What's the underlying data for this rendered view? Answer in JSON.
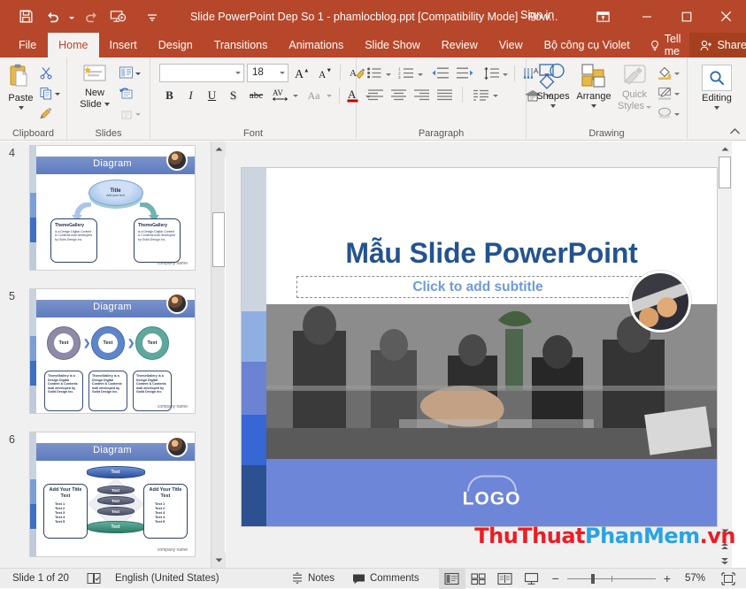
{
  "titlebar": {
    "title": "Slide PowerPoint Dep So 1 - phamlocblog.ppt [Compatibility Mode]  -  Pow...",
    "signin": "Sign in",
    "qat": [
      {
        "name": "save-icon",
        "label": "Save"
      },
      {
        "name": "undo-icon",
        "label": "Undo"
      },
      {
        "name": "redo-icon",
        "label": "Redo"
      },
      {
        "name": "start-presentation-icon",
        "label": "Start From Beginning"
      },
      {
        "name": "customize-qat-icon",
        "label": "Customize Quick Access Toolbar"
      }
    ],
    "ribbon_display_label": "Ribbon Display Options",
    "minimize_label": "Minimize",
    "maximize_label": "Restore Down",
    "close_label": "Close"
  },
  "tabs": [
    {
      "label": "File",
      "active": false
    },
    {
      "label": "Home",
      "active": true
    },
    {
      "label": "Insert",
      "active": false
    },
    {
      "label": "Design",
      "active": false
    },
    {
      "label": "Transitions",
      "active": false
    },
    {
      "label": "Animations",
      "active": false
    },
    {
      "label": "Slide Show",
      "active": false
    },
    {
      "label": "Review",
      "active": false
    },
    {
      "label": "View",
      "active": false
    },
    {
      "label": "Bộ công cụ Violet",
      "active": false
    }
  ],
  "tellme": "Tell me",
  "share": "Share",
  "ribbon": {
    "clipboard": {
      "label": "Clipboard",
      "paste": "Paste",
      "cut_label": "Cut",
      "copy_label": "Copy",
      "format_painter_label": "Format Painter"
    },
    "slides": {
      "label": "Slides",
      "new_slide_line1": "New",
      "new_slide_line2": "Slide",
      "layout_label": "Layout",
      "reset_label": "Reset",
      "section_label": "Section"
    },
    "font": {
      "label": "Font",
      "font_name_value": "",
      "font_name_placeholder": "",
      "font_size_value": "18",
      "grow_font": "A",
      "shrink_font": "A",
      "clear_formatting_label": "Clear All Formatting",
      "bold": "B",
      "italic": "I",
      "underline": "U",
      "shadow": "S",
      "strikethrough": "abc",
      "char_spacing": "AV",
      "change_case": "Aa",
      "font_color": "A"
    },
    "paragraph": {
      "label": "Paragraph",
      "bullets_label": "Bullets",
      "numbering_label": "Numbering",
      "decrease_indent_label": "Decrease List Level",
      "increase_indent_label": "Increase List Level",
      "line_spacing_label": "Line Spacing",
      "text_direction_label": "Text Direction",
      "align_text_label": "Align Text",
      "convert_smartart_label": "Convert to SmartArt",
      "align_left_label": "Align Left",
      "align_center_label": "Center",
      "align_right_label": "Align Right",
      "justify_label": "Justify",
      "columns_label": "Columns"
    },
    "drawing": {
      "label": "Drawing",
      "shapes": "Shapes",
      "arrange": "Arrange",
      "quick_styles_line1": "Quick",
      "quick_styles_line2": "Styles",
      "shape_fill_label": "Shape Fill",
      "shape_outline_label": "Shape Outline",
      "shape_effects_label": "Shape Effects"
    },
    "editing": {
      "label": "Editing",
      "button": "Editing"
    },
    "collapse_ribbon_label": "Collapse the Ribbon"
  },
  "thumbnails": [
    {
      "number": "4",
      "title": "Diagram",
      "footer": "company name",
      "center_title": "Title",
      "center_sub": "Add your text",
      "boxes": [
        {
          "heading": "ThemeGallery",
          "body": "is a Design Digital Content & Contents mall developed by Guild Design Inc."
        },
        {
          "heading": "ThemeGallery",
          "body": "is a Design Digital Content & Contents mall developed by Guild Design Inc."
        }
      ]
    },
    {
      "number": "5",
      "title": "Diagram",
      "footer": "company name",
      "circles": [
        "Text",
        "Text",
        "Text"
      ],
      "boxes": [
        "ThemeGallery is a Design Digital Content & Contents mall developed by Guild Design Inc.",
        "ThemeGallery is a Design Digital Content & Contents mall developed by Guild Design Inc.",
        "ThemeGallery is a Design Digital Content & Contents mall developed by Guild Design Inc."
      ]
    },
    {
      "number": "6",
      "title": "Diagram",
      "footer": "company name",
      "top_cyl": "Text",
      "bottom_cyl": "Text",
      "stack": [
        "Text",
        "Text",
        "Text"
      ],
      "left_panel": {
        "title": "Add Your Title Text",
        "items": [
          "Text 1",
          "Text 2",
          "Text 3",
          "Text 4",
          "Text 5"
        ]
      },
      "right_panel": {
        "title": "Add Your Title Text",
        "items": [
          "Text 1",
          "Text 2",
          "Text 3",
          "Text 4",
          "Text 5"
        ]
      }
    }
  ],
  "slide": {
    "title": "Mẫu Slide PowerPoint",
    "subtitle_placeholder": "Click to add subtitle",
    "logo_text": "LOGO",
    "leftbar_colors": [
      "#ccd5df",
      "#8fafe2",
      "#6b83d2",
      "#3667d4",
      "#2b5190"
    ],
    "title_color": "#23538f",
    "subtitle_color": "#6e9ade",
    "band_color": "#6e86d8"
  },
  "watermark": {
    "part1": "ThuThuat",
    "part2": "PhanMem",
    "part3": ".vn",
    "color1": "#ed1c24",
    "color2": "#29a3e3"
  },
  "statusbar": {
    "slide_count": "Slide 1 of 20",
    "accessibility_label": "Accessibility Checker",
    "language": "English (United States)",
    "notes": "Notes",
    "comments": "Comments",
    "view_normal_label": "Normal",
    "view_slide_sorter_label": "Slide Sorter",
    "view_reading_label": "Reading View",
    "view_slideshow_label": "Slide Show",
    "zoom_out": "−",
    "zoom_in": "+",
    "zoom_level": "57%",
    "fit_slide_label": "Fit slide to current window"
  }
}
